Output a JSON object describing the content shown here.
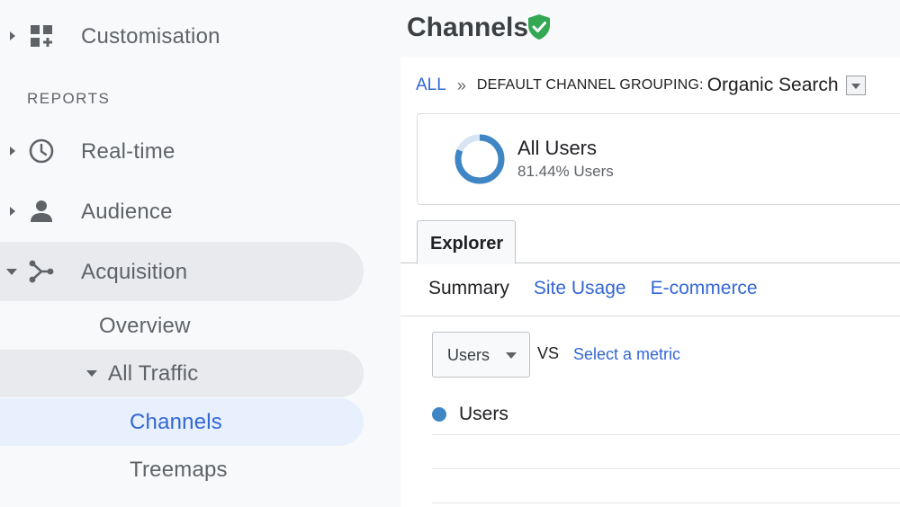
{
  "sidebar": {
    "items": [
      {
        "label": "Customisation",
        "icon": "dashboard-plus-icon"
      },
      {
        "label": "Real-time",
        "icon": "clock-icon"
      },
      {
        "label": "Audience",
        "icon": "person-icon"
      },
      {
        "label": "Acquisition",
        "icon": "acquisition-icon"
      }
    ],
    "section_label": "REPORTS",
    "acquisition_children": {
      "overview": "Overview",
      "all_traffic": "All Traffic",
      "channels": "Channels",
      "treemaps": "Treemaps"
    }
  },
  "header": {
    "title": "Channels",
    "status_icon": "verified-shield-icon"
  },
  "breadcrumb": {
    "all": "ALL",
    "separator": "»",
    "key": "DEFAULT CHANNEL GROUPING:",
    "value": "Organic Search"
  },
  "segment": {
    "name": "All Users",
    "percent_text": "81.44% Users",
    "percent_value": 81.44
  },
  "tabs": {
    "explorer": "Explorer",
    "subtabs": [
      "Summary",
      "Site Usage",
      "E-commerce"
    ]
  },
  "chart_controls": {
    "metric": "Users",
    "vs": "VS",
    "select_metric": "Select a metric",
    "legend_label": "Users"
  },
  "colors": {
    "accent_link": "#3367d6",
    "active_blue": "#3367d6",
    "donut_fill": "#3f86c4",
    "donut_track": "#d6e4f3",
    "shield_green": "#34a853",
    "active_pill": "#e8f0fe",
    "section_pill": "#e8eaed"
  }
}
